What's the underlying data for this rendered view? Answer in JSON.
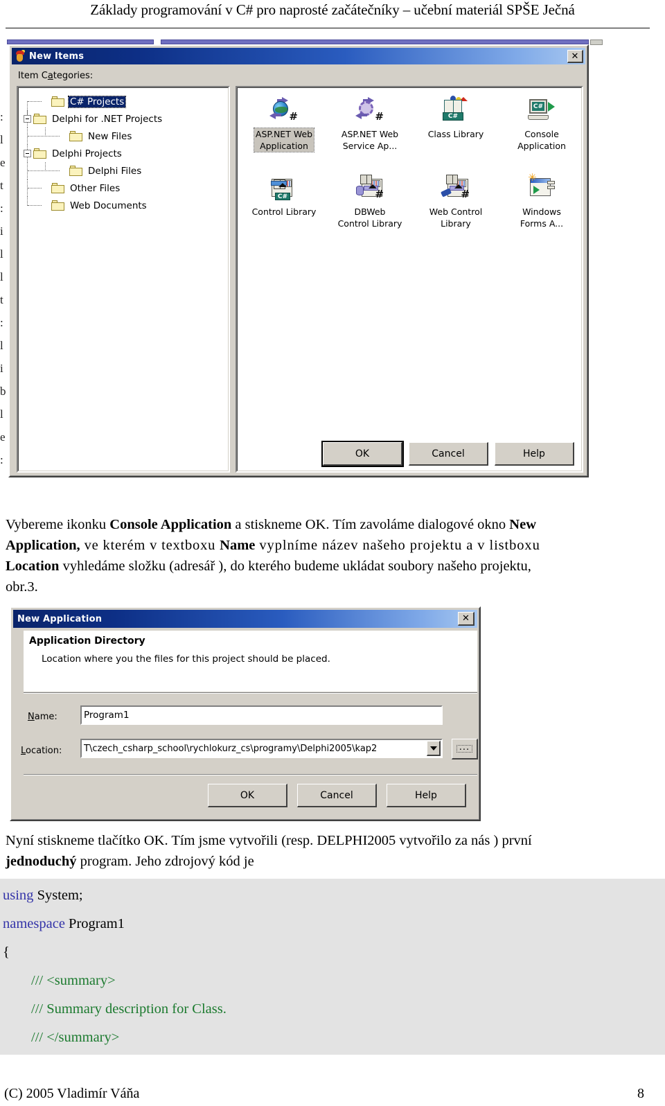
{
  "page": {
    "header_title": "Základy programování v C# pro naprosté začátečníky – učební materiál SPŠE Ječná",
    "footer_copyright": "(C) 2005  Vladimír Váňa",
    "footer_page_number": "8"
  },
  "margin_fragments": [
    ":",
    "l",
    "e",
    "t",
    ":",
    "i",
    "l",
    "l",
    "t",
    ":",
    "l",
    "i",
    "b",
    "l",
    "e",
    ":"
  ],
  "new_items_dialog": {
    "title": "New Items",
    "title_icon": "delphi-helmet-icon",
    "close_label": "✕",
    "categories_label_pre": "Item C",
    "categories_label_accel": "a",
    "categories_label_post": "tegories:",
    "tree": [
      {
        "label": "C# Projects",
        "depth": 1,
        "expander": "none",
        "selected": true
      },
      {
        "label": "Delphi for .NET Projects",
        "depth": 0,
        "expander": "minus",
        "selected": false
      },
      {
        "label": "New Files",
        "depth": 2,
        "expander": "none",
        "selected": false
      },
      {
        "label": "Delphi Projects",
        "depth": 0,
        "expander": "minus",
        "selected": false
      },
      {
        "label": "Delphi Files",
        "depth": 2,
        "expander": "none",
        "selected": false
      },
      {
        "label": "Other Files",
        "depth": 1,
        "expander": "none",
        "selected": false
      },
      {
        "label": "Web Documents",
        "depth": 1,
        "expander": "none",
        "selected": false
      }
    ],
    "items": [
      {
        "caption": "ASP.NET Web\nApplication",
        "icon": "aspnet-web-application-icon",
        "selected": true
      },
      {
        "caption": "ASP.NET Web\nService Ap...",
        "icon": "aspnet-web-service-icon",
        "selected": false
      },
      {
        "caption": "Class Library",
        "icon": "class-library-icon",
        "selected": false
      },
      {
        "caption": "Console\nApplication",
        "icon": "console-application-icon",
        "selected": false
      },
      {
        "caption": "Control Library",
        "icon": "control-library-icon",
        "selected": false
      },
      {
        "caption": "DBWeb\nControl Library",
        "icon": "dbweb-control-library-icon",
        "selected": false
      },
      {
        "caption": "Web Control\nLibrary",
        "icon": "web-control-library-icon",
        "selected": false
      },
      {
        "caption": "Windows\nForms A...",
        "icon": "windows-forms-application-icon",
        "selected": false
      }
    ],
    "buttons": {
      "ok": "OK",
      "cancel": "Cancel",
      "help": "Help"
    },
    "csharp_badge": "C#"
  },
  "paragraph_1": {
    "line1_a": "Vybereme ikonku ",
    "line1_b": "Console Application",
    "line1_c": " a stiskneme OK. Tím zavoláme dialogové okno ",
    "line1_d": "New",
    "line2_a": "Application,",
    "line2_b": " ve kterém v textboxu ",
    "line2_c": "Name",
    "line2_d": " vyplníme název našeho projektu a v listboxu",
    "line3_a": "Location",
    "line3_b": " vyhledáme složku (adresář ), do kterého budeme ukládat soubory našeho projektu,",
    "line4": "obr.3."
  },
  "new_application_dialog": {
    "title": "New Application",
    "close_label": "✕",
    "wizard_heading": "Application Directory",
    "wizard_subtext": "Location where you the files for this project should be placed.",
    "name_label_pre": "",
    "name_label_accel": "N",
    "name_label_post": "ame:",
    "name_value": "Program1",
    "location_label_accel": "L",
    "location_label_post": "ocation:",
    "location_value": "T\\czech_csharp_school\\rychlokurz_cs\\programy\\Delphi2005\\kap2",
    "browse_label": "...",
    "buttons": {
      "ok": "OK",
      "cancel": "Cancel",
      "help": "Help"
    }
  },
  "paragraph_2": {
    "line1": "Nyní stiskneme tlačítko OK. Tím jsme vytvořili (resp. DELPHI2005 vytvořilo za nás ) první",
    "line2_a": "jednoduchý",
    "line2_b": " program. Jeho zdrojový kód je"
  },
  "code": {
    "lines": [
      {
        "segments": [
          {
            "t": "using",
            "c": "kw"
          },
          {
            "t": " System;",
            "c": ""
          }
        ]
      },
      {
        "segments": [
          {
            "t": "namespace",
            "c": "kw"
          },
          {
            "t": " Program1",
            "c": ""
          }
        ]
      },
      {
        "segments": [
          {
            "t": "{",
            "c": ""
          }
        ]
      },
      {
        "segments": [
          {
            "t": "        /// <summary>",
            "c": "cmt"
          }
        ]
      },
      {
        "segments": [
          {
            "t": "        /// Summary description for Class.",
            "c": "cmt"
          }
        ]
      },
      {
        "segments": [
          {
            "t": "        /// </summary>",
            "c": "cmt"
          }
        ]
      }
    ]
  },
  "colors": {
    "dialog_face": "#d4d0c8",
    "titlebar_dark": "#0a246a",
    "titlebar_light": "#a8c8f0",
    "selection_blue": "#0a246a",
    "code_keyword": "#3333a8",
    "code_comment": "#1b7a2e",
    "code_bg": "#e3e3e3",
    "scroll_strip": "#6f6fc0"
  }
}
